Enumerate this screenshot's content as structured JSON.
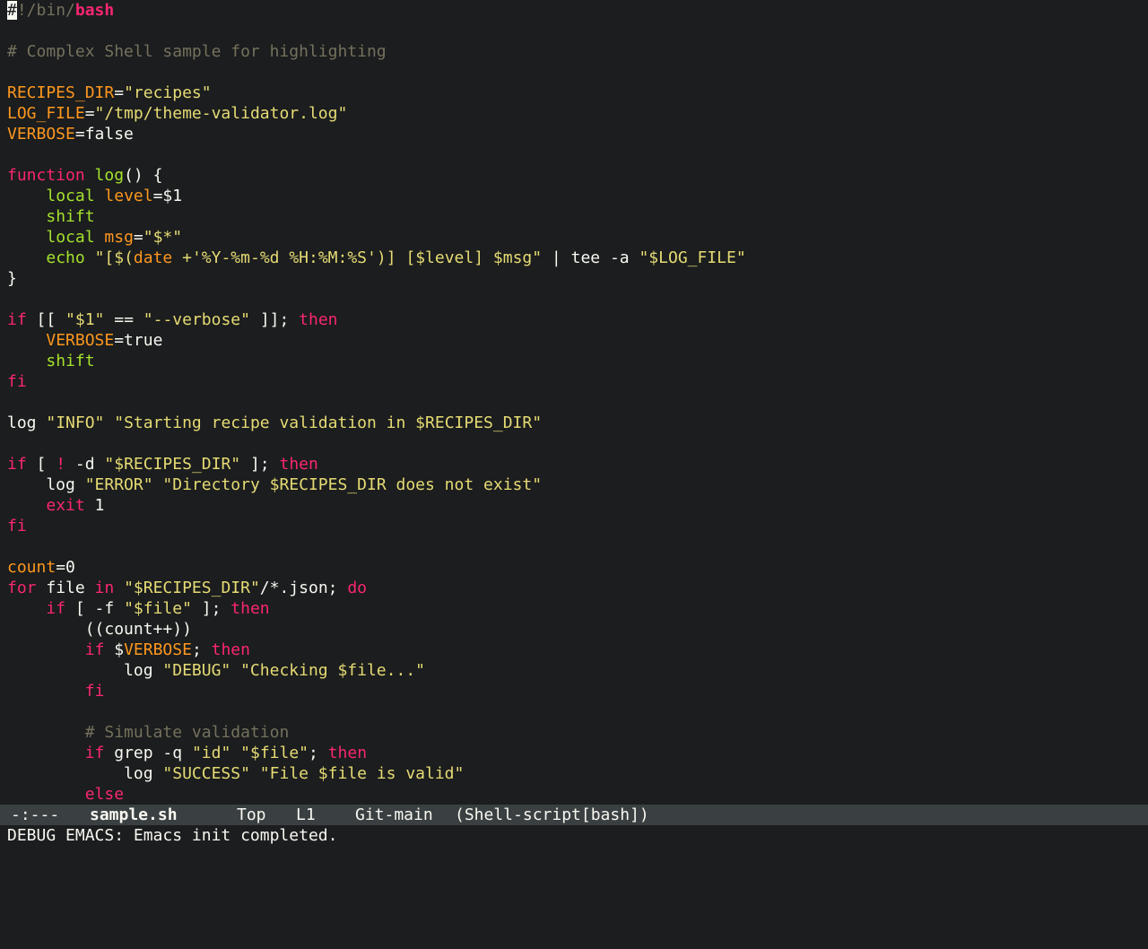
{
  "editor": {
    "lines": [
      [
        {
          "t": "#",
          "c": "cursor"
        },
        {
          "t": "!/bin/",
          "c": "cmt"
        },
        {
          "t": "bash",
          "c": "kw bold"
        }
      ],
      [],
      [
        {
          "t": "# Complex Shell sample for highlighting",
          "c": "cmt"
        }
      ],
      [],
      [
        {
          "t": "RECIPES_DIR",
          "c": "var"
        },
        {
          "t": "=",
          "c": "plain"
        },
        {
          "t": "\"recipes\"",
          "c": "str"
        }
      ],
      [
        {
          "t": "LOG_FILE",
          "c": "var"
        },
        {
          "t": "=",
          "c": "plain"
        },
        {
          "t": "\"/tmp/theme-validator.log\"",
          "c": "str"
        }
      ],
      [
        {
          "t": "VERBOSE",
          "c": "var"
        },
        {
          "t": "=false",
          "c": "plain"
        }
      ],
      [],
      [
        {
          "t": "function",
          "c": "kw"
        },
        {
          "t": " ",
          "c": "plain"
        },
        {
          "t": "log",
          "c": "fn"
        },
        {
          "t": "() {",
          "c": "plain"
        }
      ],
      [
        {
          "t": "    ",
          "c": "plain"
        },
        {
          "t": "local",
          "c": "bi"
        },
        {
          "t": " ",
          "c": "plain"
        },
        {
          "t": "level",
          "c": "var"
        },
        {
          "t": "=$1",
          "c": "plain"
        }
      ],
      [
        {
          "t": "    ",
          "c": "plain"
        },
        {
          "t": "shift",
          "c": "bi"
        }
      ],
      [
        {
          "t": "    ",
          "c": "plain"
        },
        {
          "t": "local",
          "c": "bi"
        },
        {
          "t": " ",
          "c": "plain"
        },
        {
          "t": "msg",
          "c": "var"
        },
        {
          "t": "=",
          "c": "plain"
        },
        {
          "t": "\"$*\"",
          "c": "str"
        }
      ],
      [
        {
          "t": "    ",
          "c": "plain"
        },
        {
          "t": "echo",
          "c": "bi"
        },
        {
          "t": " ",
          "c": "plain"
        },
        {
          "t": "\"[$(",
          "c": "str"
        },
        {
          "t": "date",
          "c": "var"
        },
        {
          "t": " +'%Y-%m-%d %H:%M:%S')] [$level] $msg\"",
          "c": "str"
        },
        {
          "t": " | tee -a ",
          "c": "plain"
        },
        {
          "t": "\"$LOG_FILE\"",
          "c": "str"
        }
      ],
      [
        {
          "t": "}",
          "c": "plain"
        }
      ],
      [],
      [
        {
          "t": "if",
          "c": "kw"
        },
        {
          "t": " [[ ",
          "c": "plain"
        },
        {
          "t": "\"$1\"",
          "c": "str"
        },
        {
          "t": " == ",
          "c": "plain"
        },
        {
          "t": "\"--verbose\"",
          "c": "str"
        },
        {
          "t": " ]]; ",
          "c": "plain"
        },
        {
          "t": "then",
          "c": "kw"
        }
      ],
      [
        {
          "t": "    ",
          "c": "plain"
        },
        {
          "t": "VERBOSE",
          "c": "var"
        },
        {
          "t": "=true",
          "c": "plain"
        }
      ],
      [
        {
          "t": "    ",
          "c": "plain"
        },
        {
          "t": "shift",
          "c": "bi"
        }
      ],
      [
        {
          "t": "fi",
          "c": "kw"
        }
      ],
      [],
      [
        {
          "t": "log ",
          "c": "plain"
        },
        {
          "t": "\"INFO\"",
          "c": "str"
        },
        {
          "t": " ",
          "c": "plain"
        },
        {
          "t": "\"Starting recipe validation in $RECIPES_DIR\"",
          "c": "str"
        }
      ],
      [],
      [
        {
          "t": "if",
          "c": "kw"
        },
        {
          "t": " [ ",
          "c": "plain"
        },
        {
          "t": "!",
          "c": "neg"
        },
        {
          "t": " -d ",
          "c": "plain"
        },
        {
          "t": "\"$RECIPES_DIR\"",
          "c": "str"
        },
        {
          "t": " ]; ",
          "c": "plain"
        },
        {
          "t": "then",
          "c": "kw"
        }
      ],
      [
        {
          "t": "    log ",
          "c": "plain"
        },
        {
          "t": "\"ERROR\"",
          "c": "str"
        },
        {
          "t": " ",
          "c": "plain"
        },
        {
          "t": "\"Directory $RECIPES_DIR does not exist\"",
          "c": "str"
        }
      ],
      [
        {
          "t": "    ",
          "c": "plain"
        },
        {
          "t": "exit",
          "c": "kw"
        },
        {
          "t": " 1",
          "c": "plain"
        }
      ],
      [
        {
          "t": "fi",
          "c": "kw"
        }
      ],
      [],
      [
        {
          "t": "count",
          "c": "var"
        },
        {
          "t": "=0",
          "c": "plain"
        }
      ],
      [
        {
          "t": "for",
          "c": "kw"
        },
        {
          "t": " file ",
          "c": "plain"
        },
        {
          "t": "in",
          "c": "kw"
        },
        {
          "t": " ",
          "c": "plain"
        },
        {
          "t": "\"$RECIPES_DIR\"",
          "c": "str"
        },
        {
          "t": "/*.json; ",
          "c": "plain"
        },
        {
          "t": "do",
          "c": "kw"
        }
      ],
      [
        {
          "t": "    ",
          "c": "plain"
        },
        {
          "t": "if",
          "c": "kw"
        },
        {
          "t": " [ -f ",
          "c": "plain"
        },
        {
          "t": "\"$file\"",
          "c": "str"
        },
        {
          "t": " ]; ",
          "c": "plain"
        },
        {
          "t": "then",
          "c": "kw"
        }
      ],
      [
        {
          "t": "        ((count++))",
          "c": "plain"
        }
      ],
      [
        {
          "t": "        ",
          "c": "plain"
        },
        {
          "t": "if",
          "c": "kw"
        },
        {
          "t": " $",
          "c": "plain"
        },
        {
          "t": "VERBOSE",
          "c": "var"
        },
        {
          "t": "; ",
          "c": "plain"
        },
        {
          "t": "then",
          "c": "kw"
        }
      ],
      [
        {
          "t": "            log ",
          "c": "plain"
        },
        {
          "t": "\"DEBUG\"",
          "c": "str"
        },
        {
          "t": " ",
          "c": "plain"
        },
        {
          "t": "\"Checking $file...\"",
          "c": "str"
        }
      ],
      [
        {
          "t": "        ",
          "c": "plain"
        },
        {
          "t": "fi",
          "c": "kw"
        }
      ],
      [],
      [
        {
          "t": "        ",
          "c": "plain"
        },
        {
          "t": "# Simulate validation",
          "c": "cmt"
        }
      ],
      [
        {
          "t": "        ",
          "c": "plain"
        },
        {
          "t": "if",
          "c": "kw"
        },
        {
          "t": " grep -q ",
          "c": "plain"
        },
        {
          "t": "\"id\"",
          "c": "str"
        },
        {
          "t": " ",
          "c": "plain"
        },
        {
          "t": "\"$file\"",
          "c": "str"
        },
        {
          "t": "; ",
          "c": "plain"
        },
        {
          "t": "then",
          "c": "kw"
        }
      ],
      [
        {
          "t": "            log ",
          "c": "plain"
        },
        {
          "t": "\"SUCCESS\"",
          "c": "str"
        },
        {
          "t": " ",
          "c": "plain"
        },
        {
          "t": "\"File $file is valid\"",
          "c": "str"
        }
      ],
      [
        {
          "t": "        ",
          "c": "plain"
        },
        {
          "t": "else",
          "c": "kw"
        }
      ]
    ]
  },
  "mode_line": {
    "status": "-:---",
    "buffer_name": "sample.sh",
    "position": "Top",
    "line": "L1",
    "vc": "Git-main",
    "major_mode": "(Shell-script[bash])"
  },
  "echo_area": {
    "message": "DEBUG EMACS: Emacs init completed."
  },
  "colors": {
    "background": "#1b1d1e",
    "foreground": "#f8f8f2",
    "keyword": "#f92672",
    "string": "#e6db74",
    "variable": "#fd971f",
    "comment": "#75715e",
    "builtin": "#a6e22e",
    "mode_line_bg": "#3a3f41"
  }
}
